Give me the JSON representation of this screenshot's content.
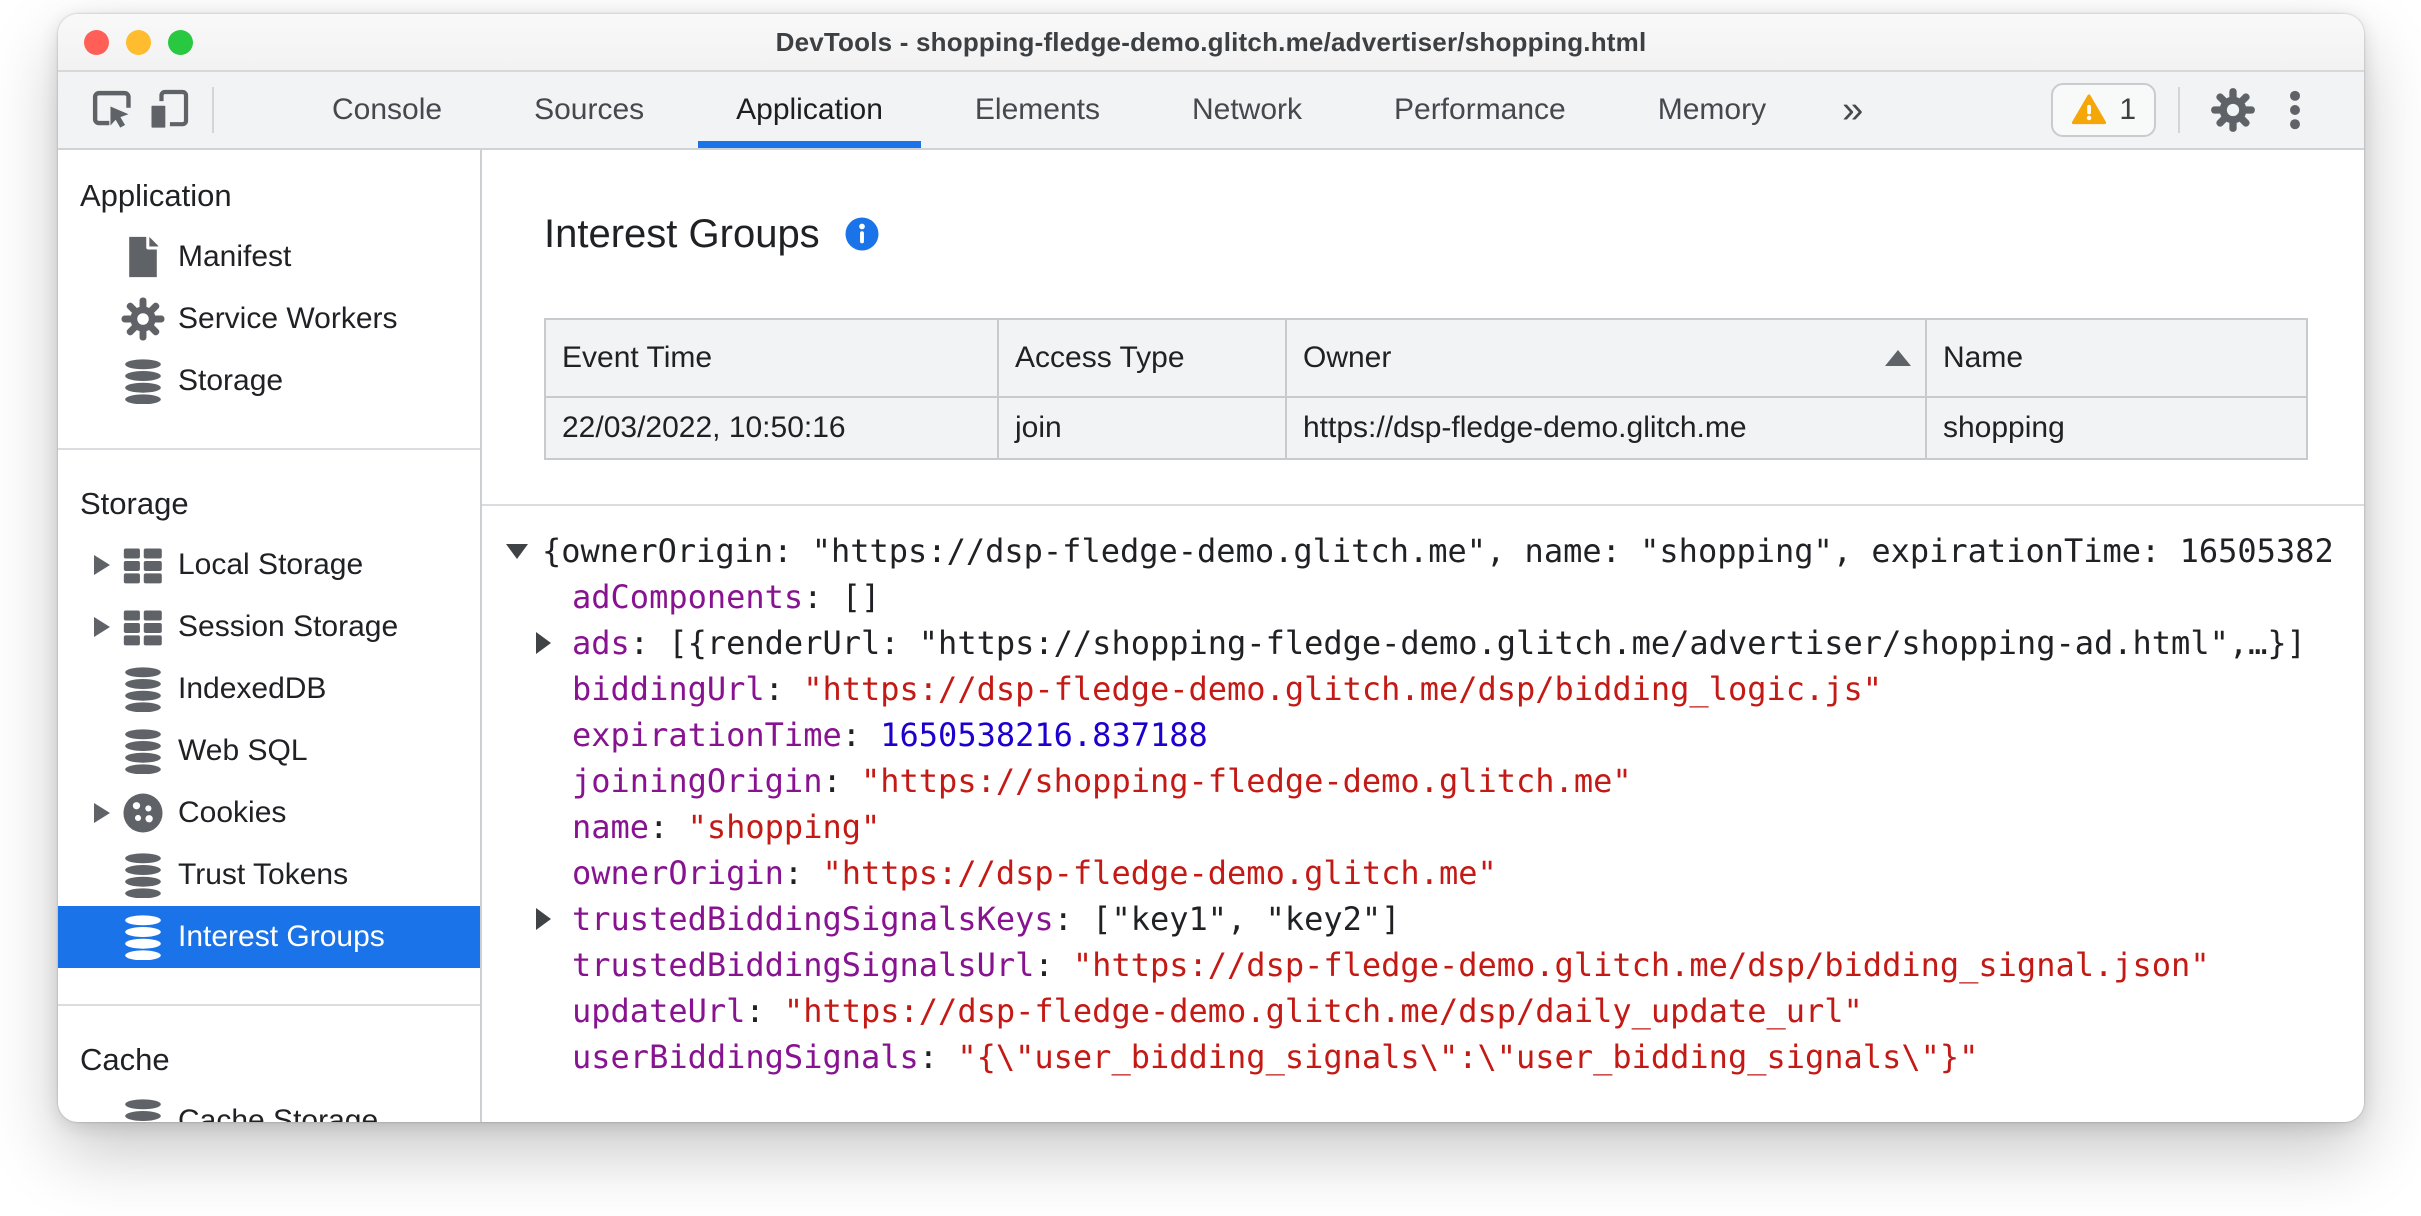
{
  "window": {
    "title": "DevTools - shopping-fledge-demo.glitch.me/advertiser/shopping.html"
  },
  "toolbar": {
    "tabs": [
      {
        "label": "Console",
        "active": false
      },
      {
        "label": "Sources",
        "active": false
      },
      {
        "label": "Application",
        "active": true
      },
      {
        "label": "Elements",
        "active": false
      },
      {
        "label": "Network",
        "active": false
      },
      {
        "label": "Performance",
        "active": false
      },
      {
        "label": "Memory",
        "active": false
      }
    ],
    "more_tabs_glyph": "»",
    "warning_badge": {
      "count": "1"
    }
  },
  "sidebar": {
    "sections": [
      {
        "header": "Application",
        "items": [
          {
            "label": "Manifest",
            "icon": "document",
            "expander": false,
            "selected": false
          },
          {
            "label": "Service Workers",
            "icon": "gear",
            "expander": false,
            "selected": false
          },
          {
            "label": "Storage",
            "icon": "database",
            "expander": false,
            "selected": false
          }
        ]
      },
      {
        "header": "Storage",
        "items": [
          {
            "label": "Local Storage",
            "icon": "table",
            "expander": true,
            "selected": false
          },
          {
            "label": "Session Storage",
            "icon": "table",
            "expander": true,
            "selected": false
          },
          {
            "label": "IndexedDB",
            "icon": "database",
            "expander": false,
            "selected": false
          },
          {
            "label": "Web SQL",
            "icon": "database",
            "expander": false,
            "selected": false
          },
          {
            "label": "Cookies",
            "icon": "cookie",
            "expander": true,
            "selected": false
          },
          {
            "label": "Trust Tokens",
            "icon": "database",
            "expander": false,
            "selected": false
          },
          {
            "label": "Interest Groups",
            "icon": "database",
            "expander": false,
            "selected": true
          }
        ]
      },
      {
        "header": "Cache",
        "items": [
          {
            "label": "Cache Storage",
            "icon": "database",
            "expander": false,
            "selected": false
          }
        ]
      }
    ]
  },
  "main": {
    "title": "Interest Groups",
    "table": {
      "columns": [
        {
          "label": "Event Time",
          "sorted": null
        },
        {
          "label": "Access Type",
          "sorted": null
        },
        {
          "label": "Owner",
          "sorted": "asc"
        },
        {
          "label": "Name",
          "sorted": null
        }
      ],
      "rows": [
        [
          "22/03/2022, 10:50:16",
          "join",
          "https://dsp-fledge-demo.glitch.me",
          "shopping"
        ]
      ]
    },
    "tree": {
      "lines": [
        {
          "expander": "down",
          "indent": 0,
          "segments": [
            {
              "type": "plain",
              "text": "{ownerOrigin: \"https://dsp-fledge-demo.glitch.me\", name: \"shopping\", expirationTime: 16505382"
            }
          ]
        },
        {
          "expander": null,
          "indent": 1,
          "segments": [
            {
              "type": "key",
              "text": "adComponents"
            },
            {
              "type": "plain",
              "text": ": []"
            }
          ]
        },
        {
          "expander": "right",
          "indent": 1,
          "segments": [
            {
              "type": "key",
              "text": "ads"
            },
            {
              "type": "plain",
              "text": ": [{renderUrl: \"https://shopping-fledge-demo.glitch.me/advertiser/shopping-ad.html\",…}]"
            }
          ]
        },
        {
          "expander": null,
          "indent": 1,
          "segments": [
            {
              "type": "key",
              "text": "biddingUrl"
            },
            {
              "type": "plain",
              "text": ": "
            },
            {
              "type": "string",
              "text": "\"https://dsp-fledge-demo.glitch.me/dsp/bidding_logic.js\""
            }
          ]
        },
        {
          "expander": null,
          "indent": 1,
          "segments": [
            {
              "type": "key",
              "text": "expirationTime"
            },
            {
              "type": "plain",
              "text": ": "
            },
            {
              "type": "number",
              "text": "1650538216.837188"
            }
          ]
        },
        {
          "expander": null,
          "indent": 1,
          "segments": [
            {
              "type": "key",
              "text": "joiningOrigin"
            },
            {
              "type": "plain",
              "text": ": "
            },
            {
              "type": "string",
              "text": "\"https://shopping-fledge-demo.glitch.me\""
            }
          ]
        },
        {
          "expander": null,
          "indent": 1,
          "segments": [
            {
              "type": "key",
              "text": "name"
            },
            {
              "type": "plain",
              "text": ": "
            },
            {
              "type": "string",
              "text": "\"shopping\""
            }
          ]
        },
        {
          "expander": null,
          "indent": 1,
          "segments": [
            {
              "type": "key",
              "text": "ownerOrigin"
            },
            {
              "type": "plain",
              "text": ": "
            },
            {
              "type": "string",
              "text": "\"https://dsp-fledge-demo.glitch.me\""
            }
          ]
        },
        {
          "expander": "right",
          "indent": 1,
          "segments": [
            {
              "type": "key",
              "text": "trustedBiddingSignalsKeys"
            },
            {
              "type": "plain",
              "text": ": [\"key1\", \"key2\"]"
            }
          ]
        },
        {
          "expander": null,
          "indent": 1,
          "segments": [
            {
              "type": "key",
              "text": "trustedBiddingSignalsUrl"
            },
            {
              "type": "plain",
              "text": ": "
            },
            {
              "type": "string",
              "text": "\"https://dsp-fledge-demo.glitch.me/dsp/bidding_signal.json\""
            }
          ]
        },
        {
          "expander": null,
          "indent": 1,
          "segments": [
            {
              "type": "key",
              "text": "updateUrl"
            },
            {
              "type": "plain",
              "text": ": "
            },
            {
              "type": "string",
              "text": "\"https://dsp-fledge-demo.glitch.me/dsp/daily_update_url\""
            }
          ]
        },
        {
          "expander": null,
          "indent": 1,
          "segments": [
            {
              "type": "key",
              "text": "userBiddingSignals"
            },
            {
              "type": "plain",
              "text": ": "
            },
            {
              "type": "string",
              "text": "\"{\\\"user_bidding_signals\\\":\\\"user_bidding_signals\\\"}\""
            }
          ]
        }
      ]
    }
  },
  "colors": {
    "accent": "#1a73e8",
    "json_key": "#881391",
    "json_string": "#c41a16",
    "json_number": "#1c00cf",
    "warning": "#f5a70a"
  }
}
